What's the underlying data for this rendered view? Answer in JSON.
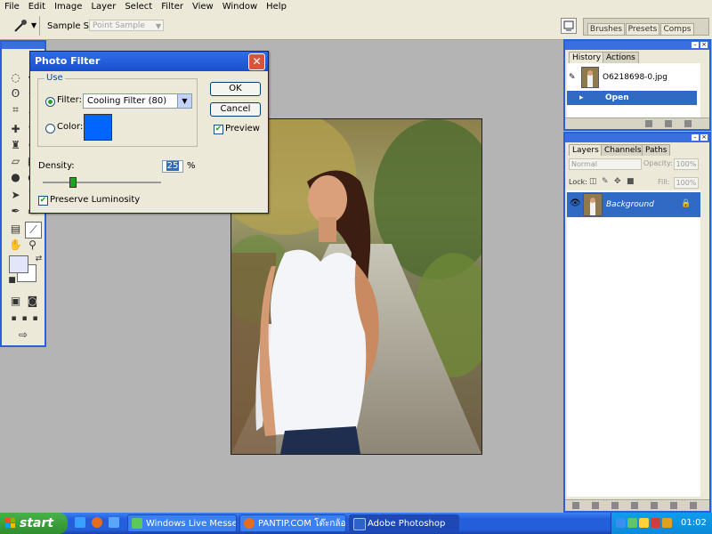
{
  "menubar": {
    "items": [
      "File",
      "Edit",
      "Image",
      "Layer",
      "Select",
      "Filter",
      "View",
      "Window",
      "Help"
    ]
  },
  "options": {
    "sample_size_label": "Sample Size:",
    "sample_size_value": "Point Sample"
  },
  "palette_well": {
    "tabs": [
      "Brushes",
      "Presets",
      "Comps"
    ]
  },
  "dialog": {
    "title": "Photo Filter",
    "use_label": "Use",
    "filter_label": "Filter:",
    "filter_value": "Cooling Filter (80)",
    "color_label": "Color:",
    "color_swatch": "#0066ff",
    "ok_label": "OK",
    "cancel_label": "Cancel",
    "preview_label": "Preview",
    "density_label": "Density:",
    "density_value": "25",
    "density_unit": "%",
    "density_fraction": 0.25,
    "preserve_label": "Preserve Luminosity"
  },
  "history": {
    "tabs": [
      "History",
      "Actions"
    ],
    "snapshot_name": "O6218698-0.jpg",
    "steps": [
      "Open"
    ]
  },
  "layers": {
    "tabs": [
      "Layers",
      "Channels",
      "Paths"
    ],
    "blend_mode": "Normal",
    "opacity_label": "Opacity:",
    "opacity_value": "100%",
    "lock_label": "Lock:",
    "fill_label": "Fill:",
    "fill_value": "100%",
    "layer_name": "Background"
  },
  "taskbar": {
    "start_label": "start",
    "tasks": [
      "Windows Live Messen...",
      "PANTIP.COM โต๊ะกล้อ...",
      "Adobe Photoshop"
    ],
    "clock": "01:02"
  }
}
